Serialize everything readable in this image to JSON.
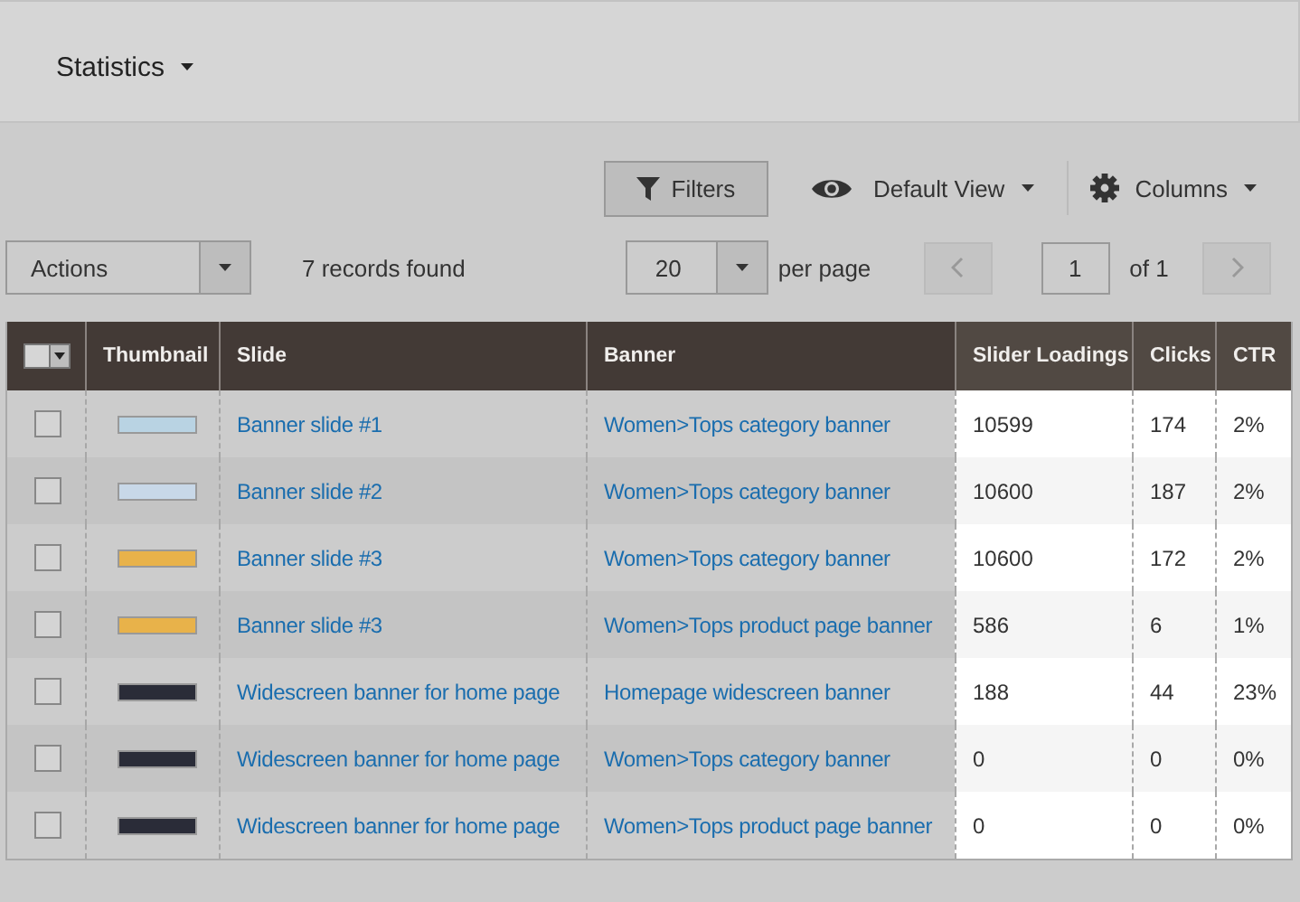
{
  "header": {
    "title": "Statistics"
  },
  "toolbar": {
    "filters": "Filters",
    "view": "Default View",
    "columns": "Columns"
  },
  "actions": {
    "label": "Actions",
    "records": "7 records found",
    "per_page_value": "20",
    "per_page_label": "per page",
    "page": "1",
    "of": "of 1"
  },
  "table": {
    "mass_select": {
      "checked": false
    },
    "columns": [
      {
        "label": "Thumbnail",
        "highlighted": false
      },
      {
        "label": "Slide",
        "highlighted": false
      },
      {
        "label": "Banner",
        "highlighted": false
      },
      {
        "label": "Slider Loadings",
        "highlighted": true
      },
      {
        "label": "Clicks",
        "highlighted": true
      },
      {
        "label": "CTR",
        "highlighted": true
      }
    ],
    "rows": [
      {
        "checked": false,
        "thumbnail": {
          "kind": "light"
        },
        "slide": "Banner slide #1",
        "banner": "Women>Tops category banner",
        "loadings": "10599",
        "clicks": "174",
        "ctr": "2%"
      },
      {
        "checked": false,
        "thumbnail": {
          "kind": "dots"
        },
        "slide": "Banner slide #2",
        "banner": "Women>Tops category banner",
        "loadings": "10600",
        "clicks": "187",
        "ctr": "2%"
      },
      {
        "checked": false,
        "thumbnail": {
          "kind": "gold"
        },
        "slide": "Banner slide #3",
        "banner": "Women>Tops category banner",
        "loadings": "10600",
        "clicks": "172",
        "ctr": "2%"
      },
      {
        "checked": false,
        "thumbnail": {
          "kind": "gold"
        },
        "slide": "Banner slide #3",
        "banner": "Women>Tops product page banner",
        "loadings": "586",
        "clicks": "6",
        "ctr": "1%"
      },
      {
        "checked": false,
        "thumbnail": {
          "kind": "dark"
        },
        "slide": "Widescreen banner for home page",
        "banner": "Homepage widescreen banner",
        "loadings": "188",
        "clicks": "44",
        "ctr": "23%"
      },
      {
        "checked": false,
        "thumbnail": {
          "kind": "dark"
        },
        "slide": "Widescreen banner for home page",
        "banner": "Women>Tops category banner",
        "loadings": "0",
        "clicks": "0",
        "ctr": "0%"
      },
      {
        "checked": false,
        "thumbnail": {
          "kind": "dark"
        },
        "slide": "Widescreen banner for home page",
        "banner": "Women>Tops product page banner",
        "loadings": "0",
        "clicks": "0",
        "ctr": "0%"
      }
    ]
  }
}
